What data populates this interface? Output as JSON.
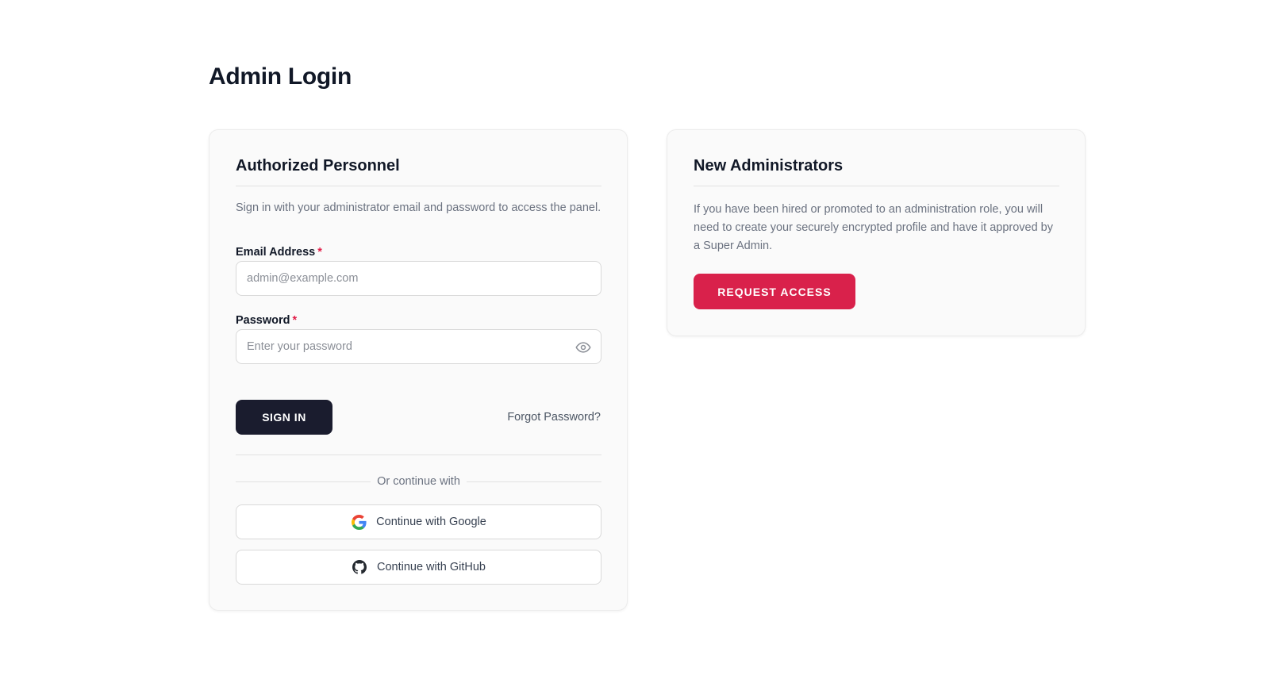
{
  "page": {
    "title": "Admin Login"
  },
  "login_card": {
    "title": "Authorized Personnel",
    "description": "Sign in with your administrator email and password to access the panel.",
    "email": {
      "label": "Email Address",
      "required_mark": "*",
      "placeholder": "admin@example.com",
      "value": ""
    },
    "password": {
      "label": "Password",
      "required_mark": "*",
      "placeholder": "Enter your password",
      "value": ""
    },
    "sign_in_label": "SIGN IN",
    "forgot_label": "Forgot Password?",
    "divider_text": "Or continue with",
    "google_label": "Continue with Google",
    "github_label": "Continue with GitHub"
  },
  "new_card": {
    "title": "New Administrators",
    "description": "If you have been hired or promoted to an administration role, you will need to create your securely encrypted profile and have it approved by a Super Admin.",
    "request_label": "REQUEST ACCESS"
  },
  "icons": {
    "eye": "eye-icon",
    "google": "google-icon",
    "github": "github-icon"
  },
  "colors": {
    "primary_dark": "#1a1c2e",
    "accent_red": "#d9214b",
    "required_red": "#e11d48",
    "card_bg": "#fafafa"
  }
}
